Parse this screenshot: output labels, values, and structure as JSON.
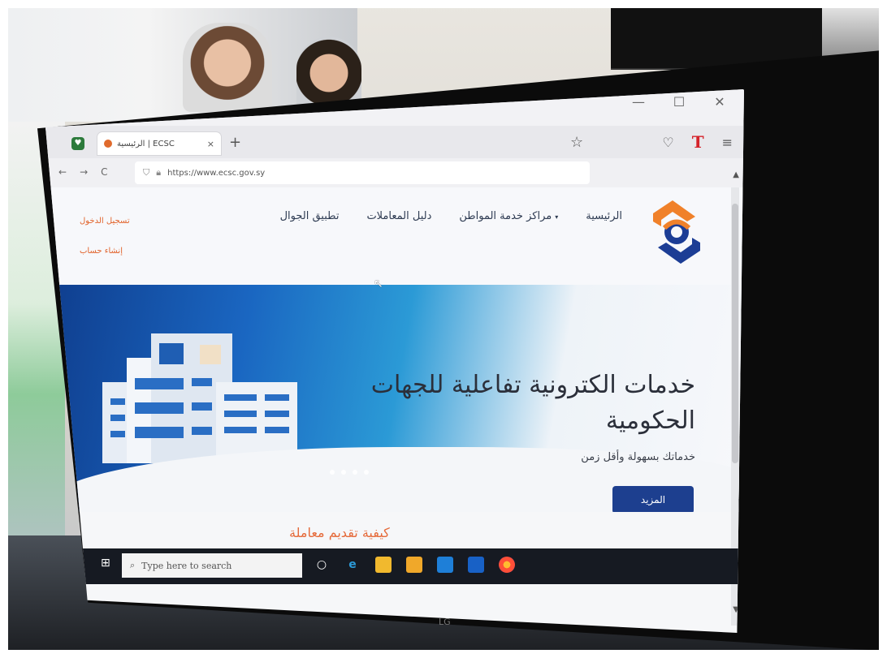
{
  "browser": {
    "tab": {
      "title": "الرئيسية | ECSC",
      "close": "×"
    },
    "new_tab": "+",
    "url": "https://www.ecsc.gov.sy",
    "window_controls": {
      "minimize": "—",
      "maximize": "☐",
      "close": "✕"
    },
    "toolbar": {
      "bookmark": "☆",
      "pocket": "♡",
      "extension": "T",
      "menu": "≡"
    },
    "nav": {
      "back": "←",
      "forward": "→",
      "reload": "C"
    }
  },
  "site": {
    "nav_items": [
      {
        "label": "الرئيسية"
      },
      {
        "label": "مراكز خدمة المواطن",
        "caret": "▾"
      },
      {
        "label": "دليل المعاملات"
      },
      {
        "label": "تطبيق الجوال"
      }
    ],
    "auth": {
      "login": "تسجيل الدخول",
      "register": "إنشاء حساب"
    },
    "hero": {
      "title": "خدمات الكترونية تفاعلية للجهات الحكومية",
      "subtitle": "خدماتك بسهولة وأقل زمن",
      "button": "المزيد"
    },
    "section_title": "كيفية تقديم معاملة"
  },
  "taskbar": {
    "search_placeholder": "Type here to search"
  },
  "monitor_brand": "LG",
  "colors": {
    "brand_orange": "#f0812a",
    "brand_blue": "#1c3d95",
    "link_orange": "#e1622a",
    "hero_blue": "#1a66c1"
  }
}
